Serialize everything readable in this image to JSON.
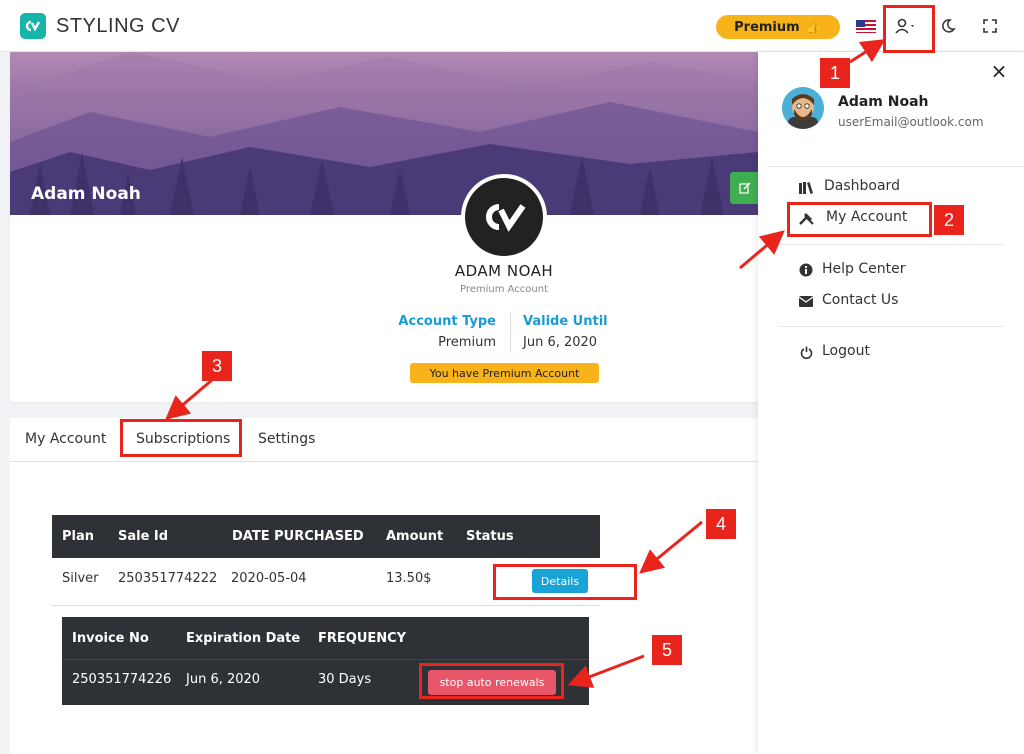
{
  "topbar": {
    "logo_text": "STYLING CV",
    "premium_label": "Premium"
  },
  "profile": {
    "banner_name": "Adam Noah",
    "name": "ADAM NOAH",
    "account_label": "Premium Account",
    "account_type_header": "Account Type",
    "account_type_value": "Premium",
    "valid_until_header": "Valide Until",
    "valid_until_value": "Jun 6, 2020",
    "premium_badge": "You have Premium Account"
  },
  "tabs": [
    {
      "label": "My Account"
    },
    {
      "label": "Subscriptions"
    },
    {
      "label": "Settings"
    }
  ],
  "subscriptions": {
    "columns": [
      "Plan",
      "Sale Id",
      "DATE PURCHASED",
      "Amount",
      "Status"
    ],
    "row": {
      "plan": "Silver",
      "sale_id": "250351774222",
      "date": "2020-05-04",
      "amount": "13.50$"
    },
    "details_label": "Details",
    "sub_columns": [
      "Invoice No",
      "Expiration Date",
      "FREQUENCY"
    ],
    "sub_row": {
      "invoice": "250351774226",
      "expiration": "Jun 6, 2020",
      "frequency": "30 Days"
    },
    "stop_label": "stop auto renewals"
  },
  "dropdown": {
    "user_name": "Adam Noah",
    "user_email": "userEmail@outlook.com",
    "items": [
      {
        "label": "Dashboard"
      },
      {
        "label": "My Account"
      },
      {
        "label": "Help Center"
      },
      {
        "label": "Contact Us"
      },
      {
        "label": "Logout"
      }
    ]
  },
  "annotations": [
    "1",
    "2",
    "3",
    "4",
    "5"
  ],
  "colors": {
    "accent": "#1a9bd1",
    "premium": "#f8b31b",
    "annotation": "#e8241c",
    "stop": "#e8566a"
  }
}
